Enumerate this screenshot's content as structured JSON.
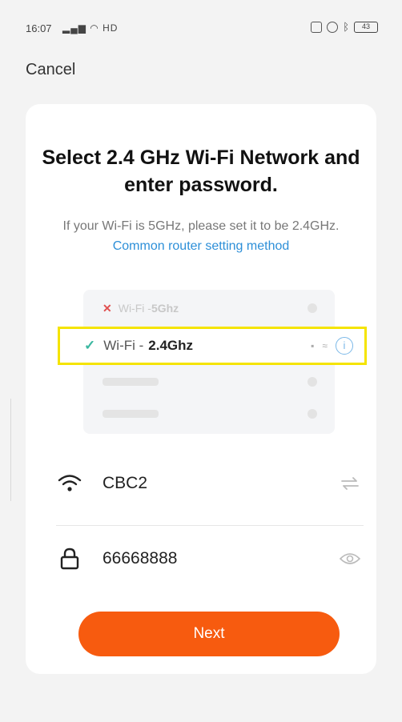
{
  "status_bar": {
    "time": "16:07",
    "network": "HD",
    "battery": "43"
  },
  "header": {
    "cancel_label": "Cancel"
  },
  "main": {
    "title": "Select 2.4 GHz Wi-Fi Network and enter password.",
    "subtitle_text": "If your Wi-Fi is 5GHz, please set it to be 2.4GHz.",
    "subtitle_link": "Common router setting method"
  },
  "illustration": {
    "row_5g_prefix": "Wi-Fi - ",
    "row_5g_band": "5Ghz",
    "row_24_prefix": "Wi-Fi - ",
    "row_24_band": "2.4Ghz"
  },
  "form": {
    "ssid_value": "CBC2",
    "password_value": "66668888"
  },
  "actions": {
    "next_label": "Next"
  },
  "colors": {
    "accent_orange": "#f75b0f",
    "link_blue": "#2d8fd8",
    "highlight_yellow": "#f5e400",
    "check_teal": "#3bb7a0"
  }
}
